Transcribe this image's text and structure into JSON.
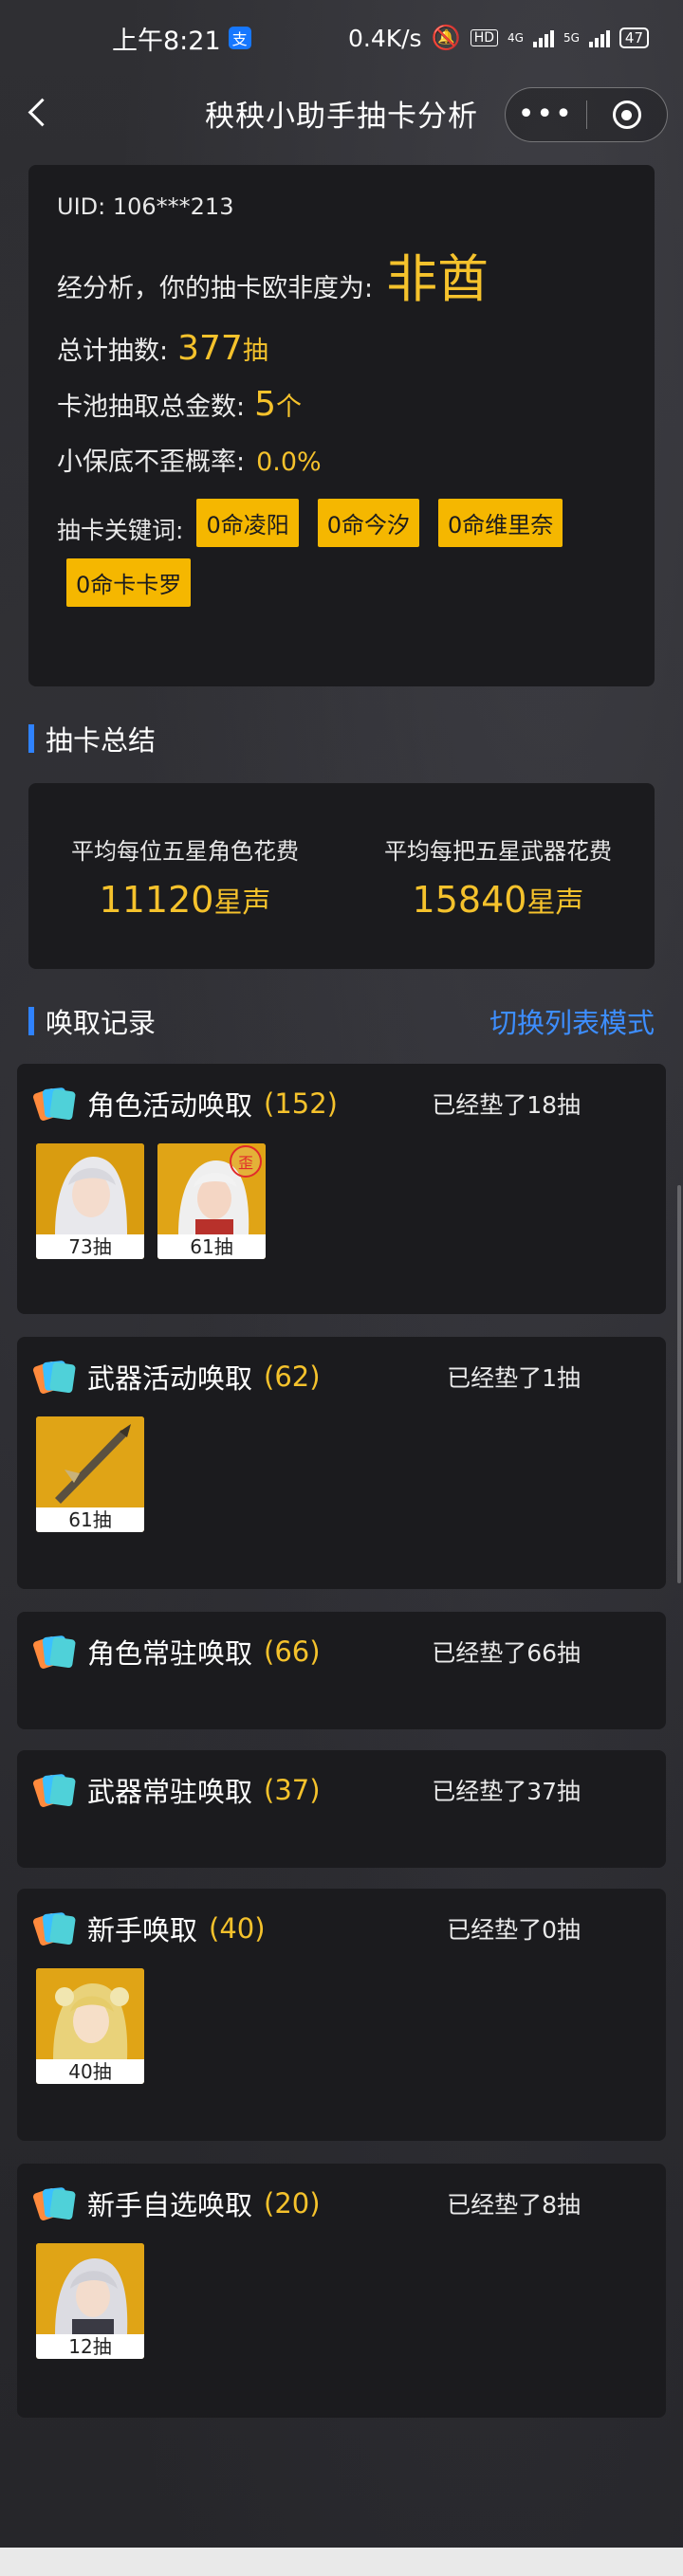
{
  "status_bar": {
    "time": "上午8:21",
    "alipay_icon": "支",
    "speed": "0.4K/s",
    "hd": "HD",
    "net1": "4G",
    "net2": "5G",
    "battery": "47"
  },
  "nav": {
    "title": "秧秧小助手抽卡分析",
    "more": "•••"
  },
  "info": {
    "uid": "UID: 106***213",
    "luck_label": "经分析，你的抽卡欧非度为:",
    "luck_value": "非酋",
    "total_label": "总计抽数:",
    "total_value": "377",
    "total_unit": "抽",
    "gold_label": "卡池抽取总金数:",
    "gold_value": "5",
    "gold_unit": "个",
    "rate_label": "小保底不歪概率:",
    "rate_value": "0.0%",
    "keyword_label": "抽卡关键词:",
    "keywords": [
      "0命凌阳",
      "0命今汐",
      "0命维里奈",
      "0命卡卡罗"
    ]
  },
  "summary": {
    "title": "抽卡总结",
    "char_label": "平均每位五星角色花费",
    "char_value": "11120",
    "char_unit": "星声",
    "weapon_label": "平均每把五星武器花费",
    "weapon_value": "15840",
    "weapon_unit": "星声"
  },
  "records": {
    "title": "唤取记录",
    "switch_label": "切换列表模式",
    "pools": [
      {
        "name": "角色活动唤取",
        "count": "(152)",
        "pity": "已经垫了18抽",
        "items": [
          {
            "label": "73抽"
          },
          {
            "label": "61抽",
            "badge": "歪"
          }
        ]
      },
      {
        "name": "武器活动唤取",
        "count": "(62)",
        "pity": "已经垫了1抽",
        "items": [
          {
            "label": "61抽"
          }
        ]
      },
      {
        "name": "角色常驻唤取",
        "count": "(66)",
        "pity": "已经垫了66抽",
        "items": []
      },
      {
        "name": "武器常驻唤取",
        "count": "(37)",
        "pity": "已经垫了37抽",
        "items": []
      },
      {
        "name": "新手唤取",
        "count": "(40)",
        "pity": "已经垫了0抽",
        "items": [
          {
            "label": "40抽"
          }
        ]
      },
      {
        "name": "新手自选唤取",
        "count": "(20)",
        "pity": "已经垫了8抽",
        "items": [
          {
            "label": "12抽"
          }
        ]
      }
    ]
  }
}
